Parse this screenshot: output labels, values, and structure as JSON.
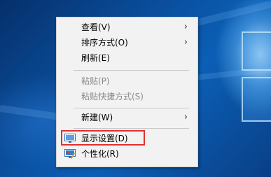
{
  "menu": {
    "items": [
      {
        "label": "查看(V)",
        "has_submenu": true,
        "enabled": true
      },
      {
        "label": "排序方式(O)",
        "has_submenu": true,
        "enabled": true
      },
      {
        "label": "刷新(E)",
        "has_submenu": false,
        "enabled": true
      },
      {
        "label": "粘贴(P)",
        "has_submenu": false,
        "enabled": false
      },
      {
        "label": "粘贴快捷方式(S)",
        "has_submenu": false,
        "enabled": false
      },
      {
        "label": "新建(W)",
        "has_submenu": true,
        "enabled": true
      },
      {
        "label": "显示设置(D)",
        "has_submenu": false,
        "enabled": true,
        "icon": "display-icon",
        "highlighted": true
      },
      {
        "label": "个性化(R)",
        "has_submenu": false,
        "enabled": true,
        "icon": "personalize-icon"
      }
    ],
    "submenu_arrow": "›"
  },
  "colors": {
    "menu_background": "#f2f2f2",
    "disabled_text": "#8a8a8a",
    "highlight_border": "#e03030",
    "desktop_blue": "#0a4f9e"
  }
}
